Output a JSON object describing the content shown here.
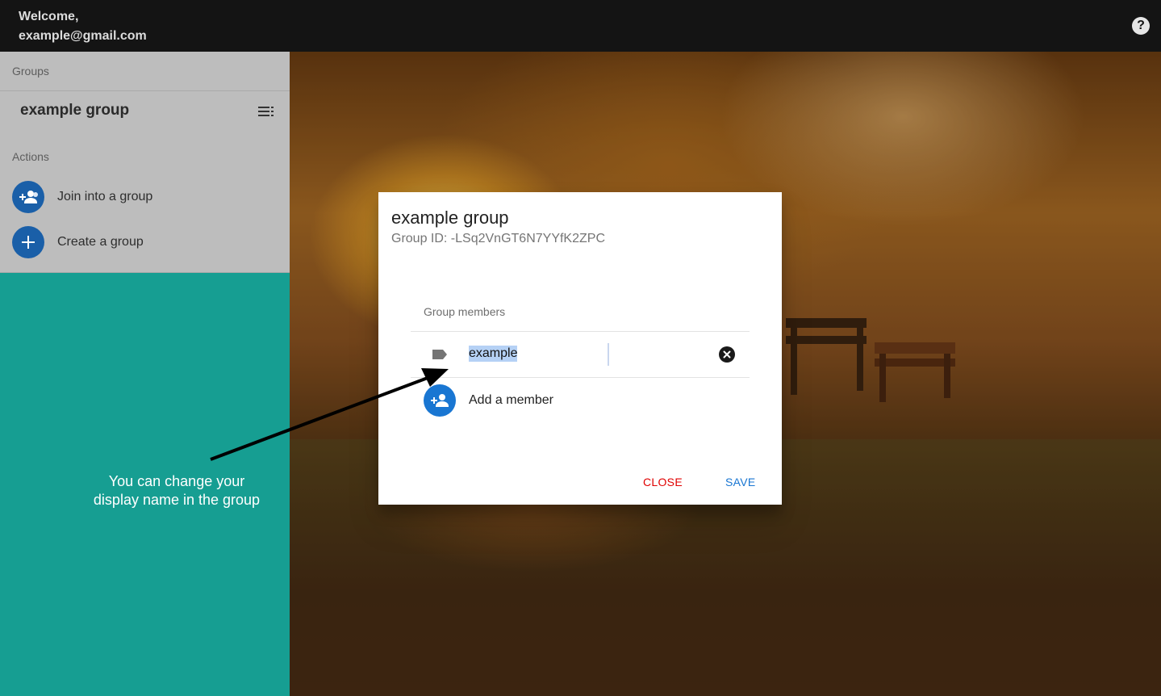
{
  "header": {
    "welcome_line1": "Welcome,",
    "welcome_line2": "example@gmail.com",
    "help_icon": "help-circle-icon"
  },
  "sidebar": {
    "groups_header": "Groups",
    "group_name": "example group",
    "group_menu_icon": "playlist-menu-icon",
    "actions_header": "Actions",
    "actions": [
      {
        "label": "Join into a group",
        "icon": "group-add-icon"
      },
      {
        "label": "Create a group",
        "icon": "plus-icon"
      }
    ]
  },
  "annotation": {
    "line1": "You can change your",
    "line2": "display name in the group"
  },
  "dialog": {
    "title": "example group",
    "subtitle": "Group ID: -LSq2VnGT6N7YYfK2ZPC",
    "members_header": "Group members",
    "member_name_value": "example",
    "member_icon": "label-icon",
    "clear_icon": "cancel-circle-icon",
    "add_member_label": "Add a member",
    "add_member_icon": "person-add-icon",
    "close_label": "CLOSE",
    "save_label": "SAVE"
  },
  "colors": {
    "topbar": "#141414",
    "sidebar": "#bdbdbd",
    "teal_panel": "#169e92",
    "primary": "#1976d2",
    "close_red": "#e00000"
  }
}
